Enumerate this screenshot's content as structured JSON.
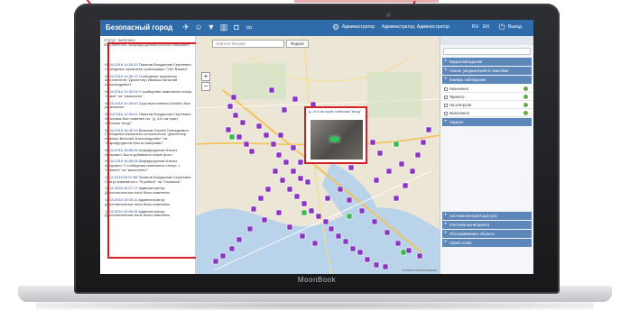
{
  "window": {
    "title": "Безопасный город"
  },
  "header": {
    "user_label": "Администратор",
    "user_name": "Администратор, Администратор",
    "logout_label": "Выход"
  },
  "log_panel": {
    "header_lines": [
      "Статус: выполнен",
      "Исполнитель: Шарафутдинова Ильгиз Амирович"
    ],
    "entries": [
      {
        "ts": "06.04.2016 14:29:20",
        "text": "Пальтов Владислав Сергеевич: Сообщение назначено организации \"УКХ Вокзал\""
      },
      {
        "ts": "06.04.2016 14:30:12",
        "text": "Сообщение назначено исполнителю \"Диспетчер Иванько Виталий Александрович\""
      },
      {
        "ts": "06.04.2016 14:32:05",
        "text": "У сообщения изменился статус: \"новое\" на \"назначено\""
      },
      {
        "ts": "06.04.2016 14:33:40",
        "text": "Срок выполнения (Srokfix) был установлен."
      },
      {
        "ts": "06.04.2016 14:33:41",
        "text": "Пальтов Владислав Сергеевич: Заголовок был изменен на: \"д. 414 на горит табличка \"вход\"\""
      },
      {
        "ts": "06.04.2016 16:40:44",
        "text": "Вальков Сергей Геннадьевич: Сообщение назначено исполнителю \"Диспетчер Иванько Виталий Александрович\" на \"Шарафутдинов Ильгиз Амирович\""
      },
      {
        "ts": "06.04.2016 16:55:06",
        "text": "Шарафутдинов Ильгиз Амирович: Было добавлено новое фото."
      },
      {
        "ts": "06.04.2016 16:55:06",
        "text": "Шарафутдинов Ильгиз Амирович: У сообщения изменился статус: с \"принято\" на \"выполнено\""
      },
      {
        "ts": "11.04.2016 09:57:58",
        "text": "Пальтов Владислав Сергеевич: Статус изменился с \"В работе\" на \"Отказано\""
      },
      {
        "ts": "11.04.2016 10:07:17",
        "text": "Администратор: Дополнительные поля были изменены."
      },
      {
        "ts": "11.04.2016 10:08:11",
        "text": "Администратор: Дополнительные поля были изменены."
      },
      {
        "ts": "11.04.2016 10:08:19",
        "text": "Администратор: Дополнительные поля были изменены."
      }
    ]
  },
  "map": {
    "search_placeholder": "Найти в Москве",
    "layer_tab": "Яндекс",
    "zoom_in": "+",
    "zoom_out": "−",
    "credit": "Условия использования",
    "popup_title": "д. 414 на горит табличка \"вход\""
  },
  "right_panel": {
    "sections": [
      "Видеонаблюдение",
      "Аналог уведомлений по жалобам",
      "Камеры наблюдения",
      "Паркинг"
    ],
    "filter_items": [
      {
        "label": "Назначено"
      },
      {
        "label": "Принято"
      },
      {
        "label": "На контроле"
      },
      {
        "label": "Выполнено"
      }
    ],
    "bottom_sections": [
      "Система контроля доступа",
      "Счетчики мониторинга",
      "Обслуживаемые объекты",
      "Архив слоев"
    ]
  },
  "laptop": {
    "brand": "MoonBook"
  },
  "colors": {
    "callout": "#c42a2a",
    "topbar": "#2f6ba8",
    "marker": "#8a35c4",
    "marker_active": "#3bbb4f"
  }
}
